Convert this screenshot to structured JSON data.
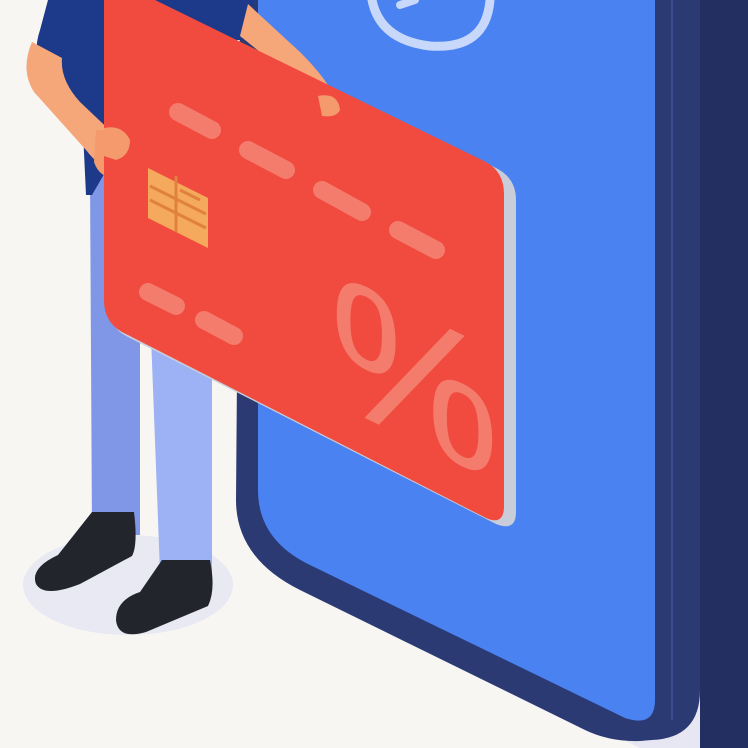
{
  "illustration": {
    "card_symbol": "%",
    "icons": [
      "checkmark-badge-icon",
      "card-chip-icon",
      "percent-icon"
    ],
    "colors": {
      "background": "#f7f6f3",
      "floor_shadow": "#e6e7f3",
      "phone_frame": "#2c3a74",
      "phone_frame_side": "#232f60",
      "phone_screen": "#4a82f1",
      "card_face": "#f14a3e",
      "card_edge": "#c9ccd9",
      "card_symbol": "#f47c6d",
      "chip": "#f4a95c",
      "shirt": "#1d3a8a",
      "trousers": "#8aa2ef",
      "skin": "#f6a77a",
      "shoes": "#22252c"
    }
  }
}
